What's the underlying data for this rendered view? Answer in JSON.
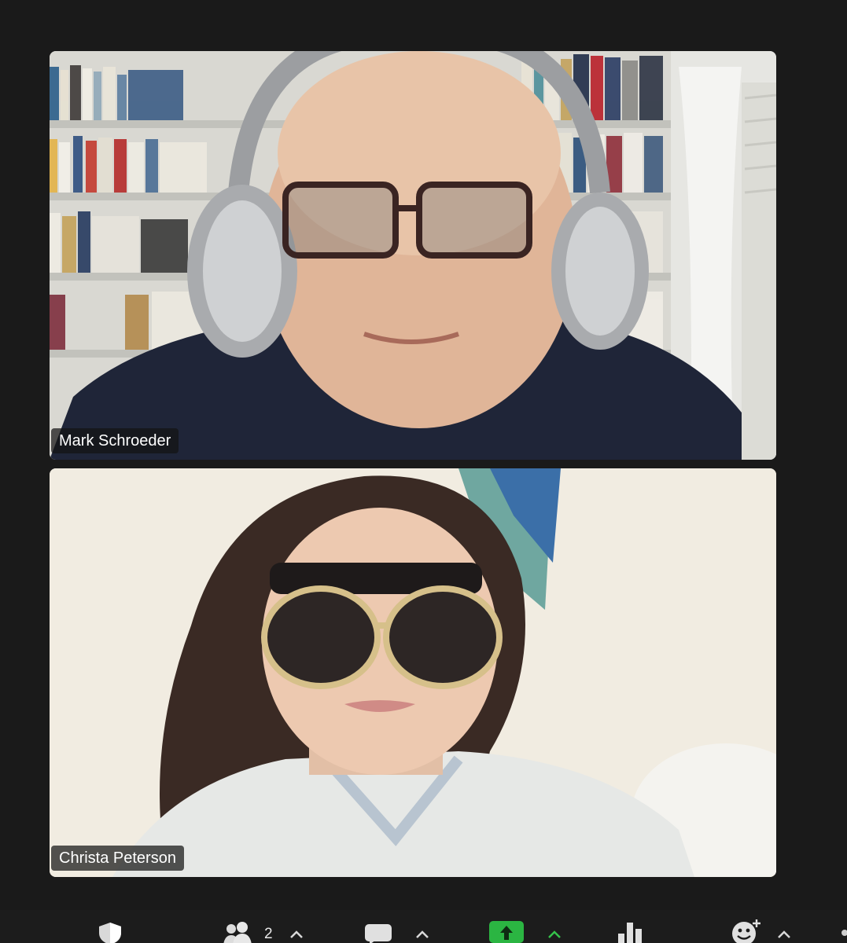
{
  "participants": [
    {
      "name": "Mark Schroeder"
    },
    {
      "name": "Christa Peterson"
    }
  ],
  "toolbar": {
    "security_icon": "shield-icon",
    "participants_icon": "people-icon",
    "participants_count": "2",
    "chat_icon": "chat-bubble-icon",
    "share_icon": "share-screen-arrow-icon",
    "polls_icon": "bar-chart-icon",
    "reactions_icon": "smiley-plus-icon"
  },
  "colors": {
    "background": "#1a1a1a",
    "share_green": "#2bb542",
    "caret_green": "#35c24a"
  }
}
